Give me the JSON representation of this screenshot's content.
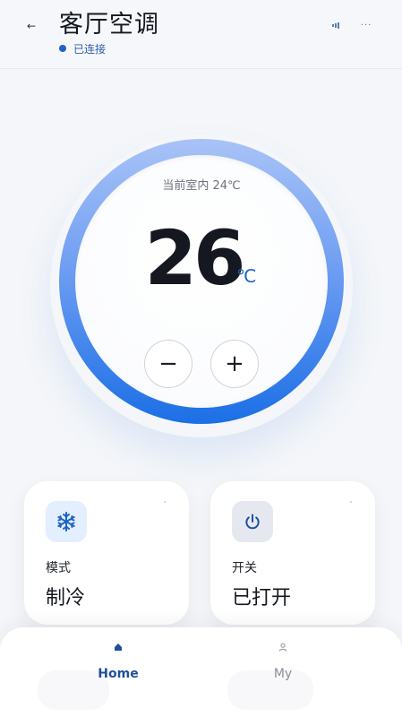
{
  "header": {
    "title": "客厅空调",
    "status": "已连接",
    "back_icon": "←",
    "more_icon": "···"
  },
  "dial": {
    "indoor_label": "当前室内 24℃",
    "temperature": "26",
    "unit": "℃",
    "minus_label": "−",
    "plus_label": "+"
  },
  "cards": {
    "mode": {
      "label": "模式",
      "value": "制冷",
      "icon": "snowflake-icon"
    },
    "power": {
      "label": "开关",
      "value": "已打开",
      "icon": "power-icon"
    }
  },
  "nav": {
    "home_label": "Home",
    "my_label": "My"
  },
  "colors": {
    "accent": "#1f63c6",
    "ring_top": "#a9c3f7",
    "ring_bottom": "#1b6fe6",
    "background": "#f4f6f9"
  }
}
